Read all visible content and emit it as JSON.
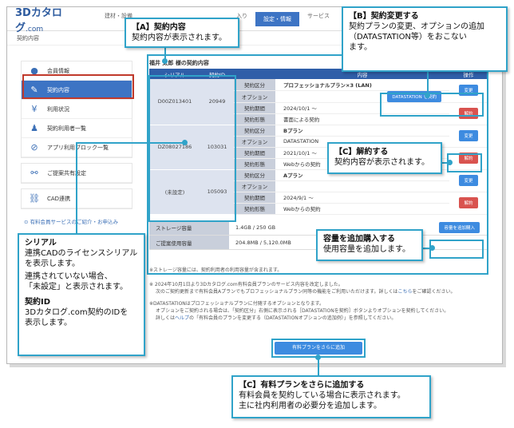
{
  "app": {
    "logo": "3Dカタログ",
    "logo_suffix": ".com",
    "nav": [
      "建材・設備",
      "入り",
      "設定・情報",
      "サービス",
      "ログ"
    ],
    "breadcrumb": "契約内容"
  },
  "sidebar": {
    "items": [
      {
        "label": "会員情報",
        "icon": "person-icon"
      },
      {
        "label": "契約内容",
        "icon": "contract-edit-icon"
      },
      {
        "label": "利用状況",
        "icon": "yen-icon"
      },
      {
        "label": "契約利用者一覧",
        "icon": "users-icon"
      },
      {
        "label": "アプリ利用ブロック一覧",
        "icon": "block-icon"
      },
      {
        "label": "ご提案共有設定",
        "icon": "share-icon"
      },
      {
        "label": "CAD連携",
        "icon": "link-icon"
      }
    ],
    "footer_link": "有料会員サービスのご紹介・お申込み"
  },
  "main": {
    "title": "福井 太郎 様の契約内容",
    "columns": [
      "シリアル",
      "契約ID",
      "内容",
      "操作"
    ],
    "contracts": [
      {
        "serial": "D00Z013401",
        "id": "20949",
        "rows": [
          {
            "label": "契約区分",
            "value": "プロフェッショナルプラン×3 (LAN)"
          },
          {
            "label": "オプション",
            "value": ""
          },
          {
            "label": "契約期間",
            "value": "2024/10/1 ～"
          },
          {
            "label": "契約形態",
            "value": "書面による契約"
          }
        ],
        "option_button": "DATASTATION を契約",
        "change_button": "変更",
        "cancel_button": "解約"
      },
      {
        "serial": "DZ08027186",
        "id": "103031",
        "rows": [
          {
            "label": "契約区分",
            "value": "Bプラン"
          },
          {
            "label": "オプション",
            "value": "DATASTATION"
          },
          {
            "label": "契約期間",
            "value": "2021/10/1 ～"
          },
          {
            "label": "契約形態",
            "value": "Webからの契約"
          }
        ],
        "change_button": "変更",
        "cancel_button": "解約"
      },
      {
        "serial": "(未設定)",
        "id": "105093",
        "rows": [
          {
            "label": "契約区分",
            "value": "Aプラン"
          },
          {
            "label": "オプション",
            "value": ""
          },
          {
            "label": "契約期間",
            "value": "2024/9/1 ～"
          },
          {
            "label": "契約形態",
            "value": "Webからの契約"
          }
        ],
        "change_button": "変更",
        "cancel_button": "解約"
      }
    ],
    "storage": {
      "label": "ストレージ容量",
      "value": "1.4GB / 250 GB",
      "button": "容量を追加購入"
    },
    "proposal": {
      "label": "ご提案使用容量",
      "value": "204.8MB / 5,120.0MB"
    },
    "notes": {
      "storage_note": "※ストレージ容量には、契約利用者の利用容量が含まれます。",
      "plan_note_1": "※ 2024年10月1日より3Dカタログ.com有料会員プランのサービス内容を改定しました。",
      "plan_note_2": "次のご契約更新まで有料会員Aプランでもプロフェッショナルプラン同等の機能をご利用いただけます。詳しくは",
      "plan_note_link": "こちら",
      "plan_note_3": "をご確認ください。",
      "ds_note_1": "※DATASTATIONはプロフェッショナルプランに付随するオプションとなります。",
      "ds_note_2": "オプションをご契約される場合は、「契約区分」右側に表示される［DATASTATIONを契約］ボタンよりオプションを契約してください。",
      "ds_note_3": "詳しくは",
      "ds_note_link": "ヘルプ",
      "ds_note_4": "の「有料会員のプランを変更する（DATASTATIONオプションの追加例）」を参照してください。"
    },
    "add_plan_button": "有料プランをさらに追加"
  },
  "callouts": {
    "a_title": "【A】契約内容",
    "a_body": "契約内容が表示されます。",
    "b_title": "【B】契約変更する",
    "b_body_1": "契約プランの変更、オプションの追加",
    "b_body_2": "（DATASTATION等）をおこない",
    "b_body_3": "ます。",
    "c1_title": "【C】解約する",
    "c1_body": "契約内容が表示されます。",
    "storage_title": "容量を追加購入する",
    "storage_body": "使用容量を追加します。",
    "serial_title": "シリアル",
    "serial_body_1": "連携CADのライセンスシリアル",
    "serial_body_2": "を表示します。",
    "serial_body_3": "連携されていない場合、",
    "serial_body_4": "「未設定」と表示されます。",
    "id_title": "契約ID",
    "id_body_1": "3Dカタログ.com契約のIDを",
    "id_body_2": "表示します。",
    "c2_title": "【C】有料プランをさらに追加する",
    "c2_body_1": "有料会員を契約している場合に表示されます。",
    "c2_body_2": "主に社内利用者の必要分を追加します。"
  },
  "colors": {
    "accent": "#3d74c4",
    "callout_border": "#30a3c9",
    "danger": "#d9534f",
    "highlight_red": "#c0392b"
  }
}
